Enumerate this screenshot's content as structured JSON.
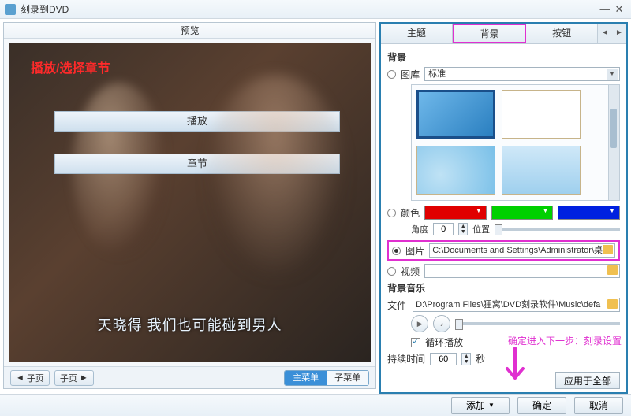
{
  "window": {
    "title": "刻录到DVD"
  },
  "preview": {
    "header": "预览",
    "overlay_text": "播放/选择章节",
    "play_btn": "播放",
    "chapter_btn": "章节",
    "subtitle": "天晓得  我们也可能碰到男人",
    "nav_prev": "子页",
    "seg_main": "主菜单",
    "seg_sub": "子菜单"
  },
  "tabs": {
    "theme": "主题",
    "background": "背景",
    "button": "按钮"
  },
  "panel": {
    "section_bg": "背景",
    "opt_library": "图库",
    "library_value": "标准",
    "opt_color": "颜色",
    "angle_label": "角度",
    "angle_value": "0",
    "position_label": "位置",
    "opt_image": "图片",
    "image_path": "C:\\Documents and Settings\\Administrator\\桌面",
    "opt_video": "视频",
    "section_music": "背景音乐",
    "file_label": "文件",
    "music_path": "D:\\Program Files\\狸窝\\DVD刻录软件\\Music\\defa",
    "loop_label": "循环播放",
    "duration_label": "持续时间",
    "duration_value": "60",
    "duration_unit": "秒",
    "apply_all": "应用于全部"
  },
  "annotation": {
    "next_step": "确定进入下一步：刻录设置"
  },
  "bottom": {
    "add": "添加",
    "ok": "确定",
    "cancel": "取消"
  }
}
